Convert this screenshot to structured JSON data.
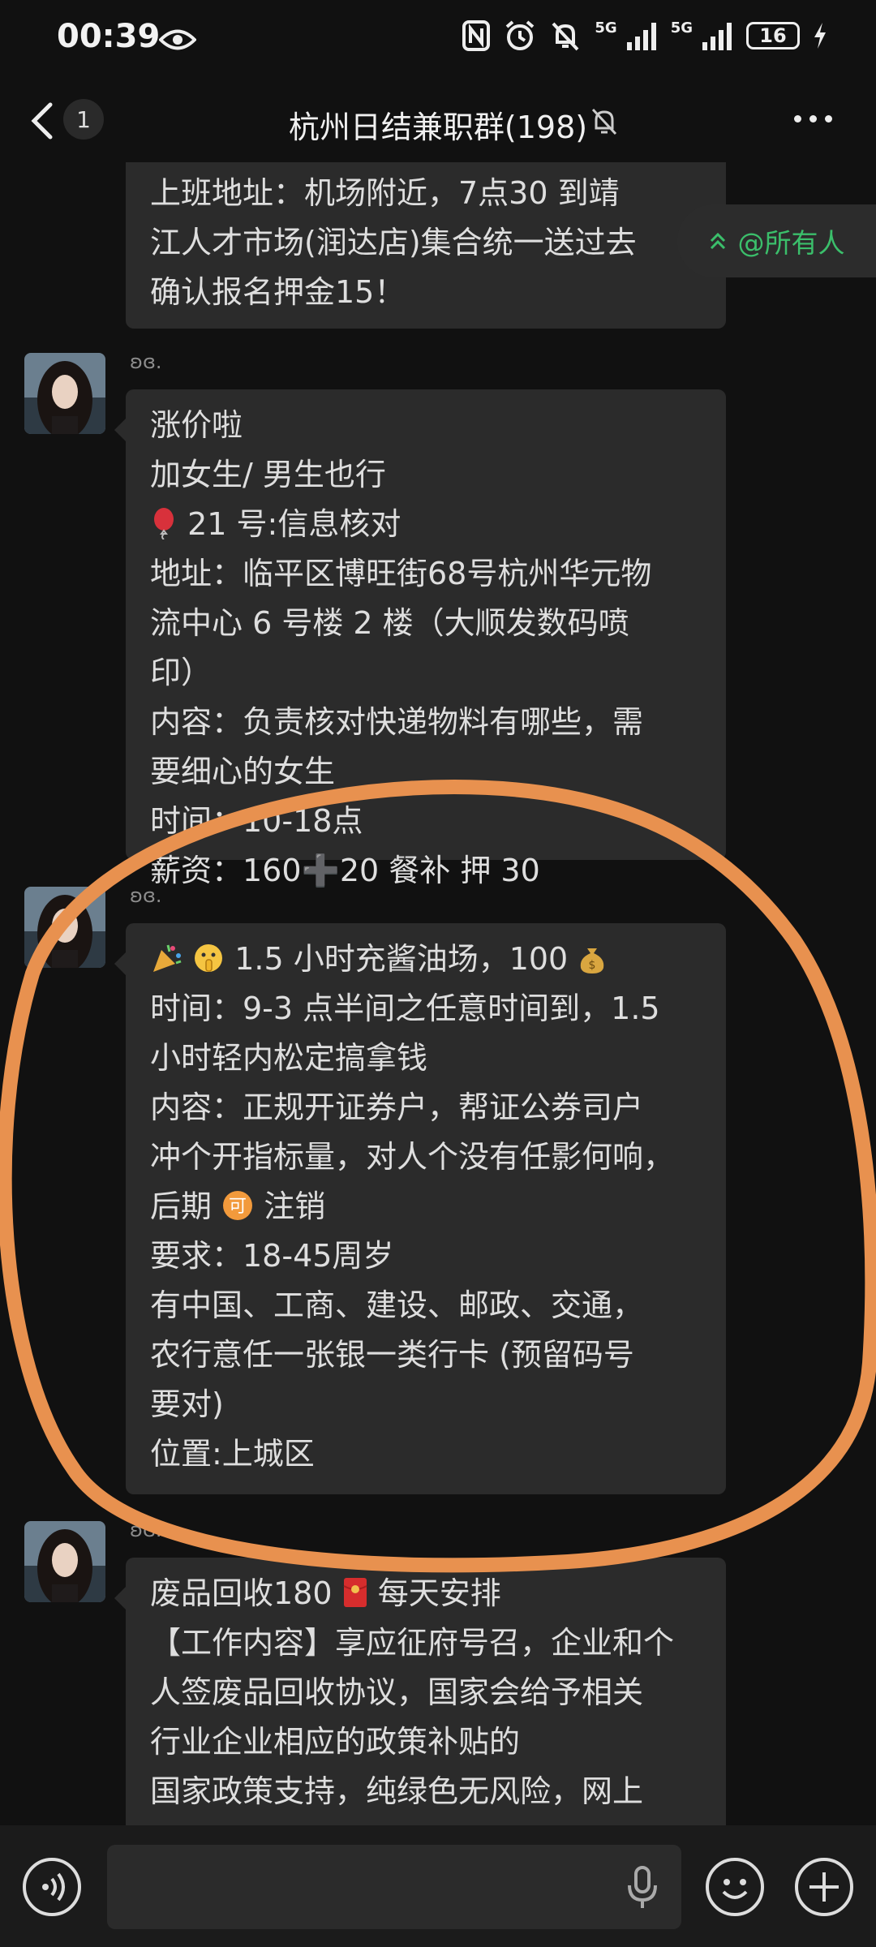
{
  "status_bar": {
    "time": "00:39",
    "signal1": "5G",
    "signal2": "5G",
    "battery": "16"
  },
  "header": {
    "unread_count": "1",
    "title": "杭州日结兼职群(198)"
  },
  "mention_badge": {
    "label": "@所有人"
  },
  "messages": [
    {
      "lines": [
        "上班地址：机场附近，7点30 到靖",
        "江人才市场(润达店)集合统一送过去",
        "确认报名押金15！"
      ]
    },
    {
      "sender": "ʚɞ.",
      "lines": [
        "涨价啦",
        "加女生/ 男生也行",
        "21 号:信息核对",
        "地址：临平区博旺街68号杭州华元物",
        "流中心 6 号楼 2 楼（大顺发数码喷",
        "印）",
        "内容：负责核对快递物料有哪些，需",
        "要细心的女生",
        "时间：10-18点",
        "薪资：160➕20 餐补 押 30"
      ]
    },
    {
      "sender": "ʚɞ.",
      "lines": [
        "1.5 小时充酱油场，100",
        "时间：9-3 点半间之任意时间到，1.5",
        "小时轻内松定搞拿钱",
        "内容：正规开证券户，帮证公券司户",
        "冲个开指标量，对人个没有任影何响，",
        "后期注销",
        "要求：18-45周岁",
        "有中国、工商、建设、邮政、交通，",
        "农行意任一张银一类行卡 (预留码号",
        "要对)",
        "位置:上城区"
      ]
    },
    {
      "sender": "ʚɞ.",
      "lines": [
        "废品回收180 每天安排",
        "【工作内容】享应征府号召，企业和个",
        "人签废品回收协议，国家会给予相关",
        "行业企业相应的政策补贴的",
        "国家政策支持，纯绿色无风险，网上"
      ]
    }
  ],
  "icons": {
    "balloon": "balloon-icon",
    "party": "party-popper-icon",
    "shush": "shushing-face-icon",
    "money": "money-bag-icon",
    "ke": "ke-badge-icon",
    "red_envelope": "red-envelope-icon"
  },
  "colors": {
    "background": "#111111",
    "bubble": "#2b2b2b",
    "accent_green": "#3bbf6b",
    "annotation_orange": "#e8914f"
  }
}
